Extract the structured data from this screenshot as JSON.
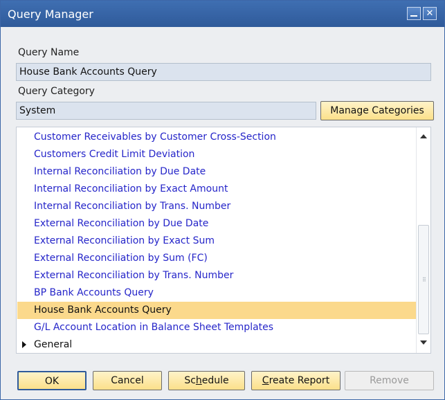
{
  "window": {
    "title": "Query Manager"
  },
  "titlebar": {
    "min_glyph": "",
    "close_glyph": "✕"
  },
  "form": {
    "query_name_label": "Query Name",
    "query_name_value": "House Bank Accounts Query",
    "query_category_label": "Query Category",
    "query_category_value": "System",
    "manage_categories_label": "Manage Categories"
  },
  "list": {
    "items": [
      {
        "label": "Customer Receivables by Customer Cross-Section"
      },
      {
        "label": "Customers Credit Limit Deviation"
      },
      {
        "label": "Internal Reconciliation by Due Date"
      },
      {
        "label": "Internal Reconciliation by Exact Amount"
      },
      {
        "label": "Internal Reconciliation by Trans. Number"
      },
      {
        "label": "External Reconciliation by Due Date"
      },
      {
        "label": "External Reconciliation by Exact Sum"
      },
      {
        "label": "External Reconciliation by Sum (FC)"
      },
      {
        "label": "External Reconciliation by Trans. Number"
      },
      {
        "label": "BP Bank Accounts Query"
      },
      {
        "label": "House Bank Accounts Query",
        "selected": true
      },
      {
        "label": "G/L Account Location in Balance Sheet Templates"
      },
      {
        "label": "General",
        "group": true,
        "collapsed": true
      }
    ]
  },
  "buttons": {
    "ok": "OK",
    "cancel": "Cancel",
    "schedule_pre": "Sc",
    "schedule_u": "h",
    "schedule_post": "edule",
    "create_u": "C",
    "create_post": "reate Report",
    "remove": "Remove"
  },
  "colors": {
    "accent": "#2f5a9a",
    "selection": "#fbd98c",
    "link": "#2525c9",
    "button": "#fbe08a"
  }
}
